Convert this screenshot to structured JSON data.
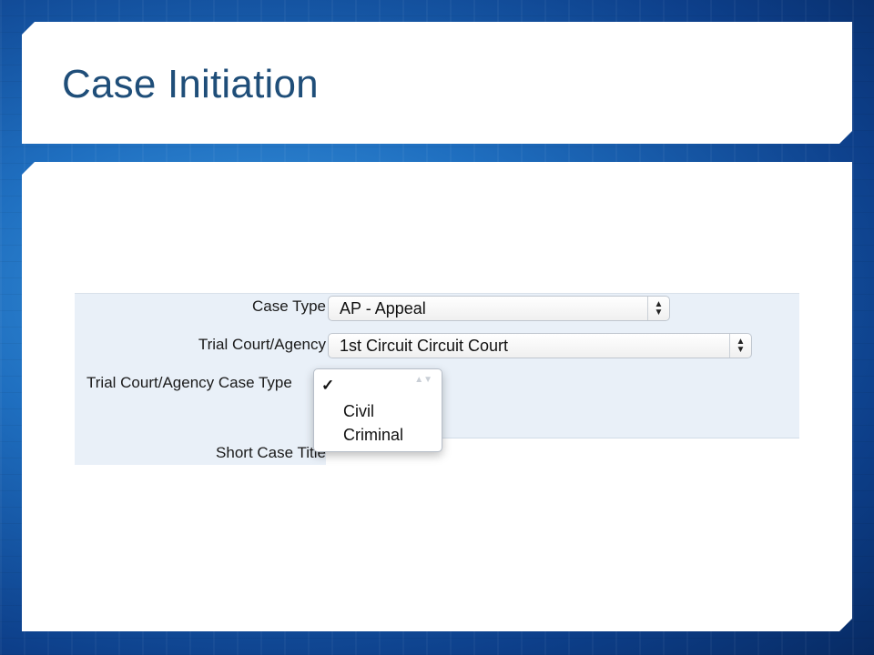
{
  "slide": {
    "title": "Case Initiation"
  },
  "form": {
    "case_type": {
      "label": "Case Type",
      "value": "AP - Appeal"
    },
    "trial_court": {
      "label": "Trial Court/Agency",
      "value": "1st Circuit Circuit Court"
    },
    "trial_court_case_type": {
      "label": "Trial Court/Agency Case Type",
      "checkmark": "✓",
      "options": [
        "Civil",
        "Criminal"
      ]
    },
    "short_case_title": {
      "label": "Short Case Title"
    }
  },
  "colors": {
    "title": "#1f4e79",
    "form_background": "#e9f0f8",
    "background_blue": "#1f6fc0"
  },
  "icons": {
    "select_arrows": "up-down-arrows-icon",
    "check": "checkmark-icon"
  }
}
